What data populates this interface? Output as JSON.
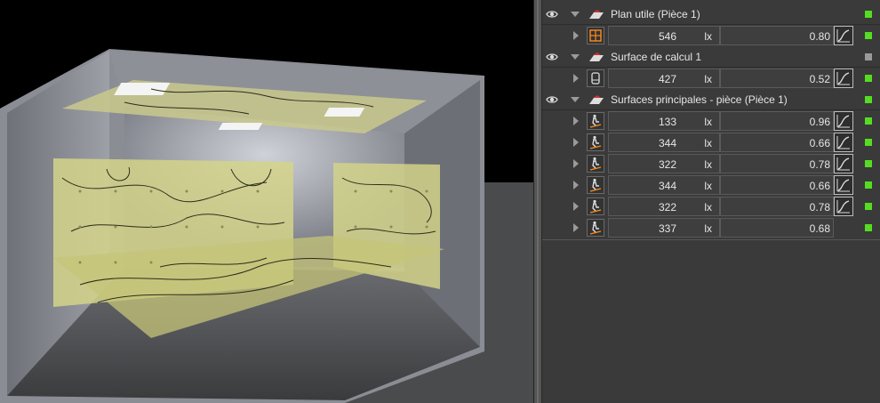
{
  "colors": {
    "active": "#55dd22",
    "inactive": "#9a9a9a",
    "grid_icon": "#ff8c1a"
  },
  "groups": [
    {
      "title": "Plan utile (Pièce 1)",
      "status": "active"
    },
    {
      "title": "Surface de calcul 1",
      "status": "inactive"
    },
    {
      "title": "Surfaces principales - pièce (Pièce 1)",
      "status": "active"
    }
  ],
  "rows": [
    {
      "icon": "grid-icon",
      "value": "546",
      "unit": "lx",
      "ratio": "0.80",
      "graph": true
    },
    {
      "icon": "surface-icon",
      "value": "427",
      "unit": "lx",
      "ratio": "0.52",
      "graph": true
    },
    {
      "icon": "person-icon",
      "value": "133",
      "unit": "lx",
      "ratio": "0.96",
      "graph": true
    },
    {
      "icon": "person-icon",
      "value": "344",
      "unit": "lx",
      "ratio": "0.66",
      "graph": true
    },
    {
      "icon": "person-icon",
      "value": "322",
      "unit": "lx",
      "ratio": "0.78",
      "graph": true
    },
    {
      "icon": "person-icon",
      "value": "344",
      "unit": "lx",
      "ratio": "0.66",
      "graph": true
    },
    {
      "icon": "person-icon",
      "value": "322",
      "unit": "lx",
      "ratio": "0.78",
      "graph": true
    },
    {
      "icon": "person-icon",
      "value": "337",
      "unit": "lx",
      "ratio": "0.68",
      "graph": false
    }
  ]
}
